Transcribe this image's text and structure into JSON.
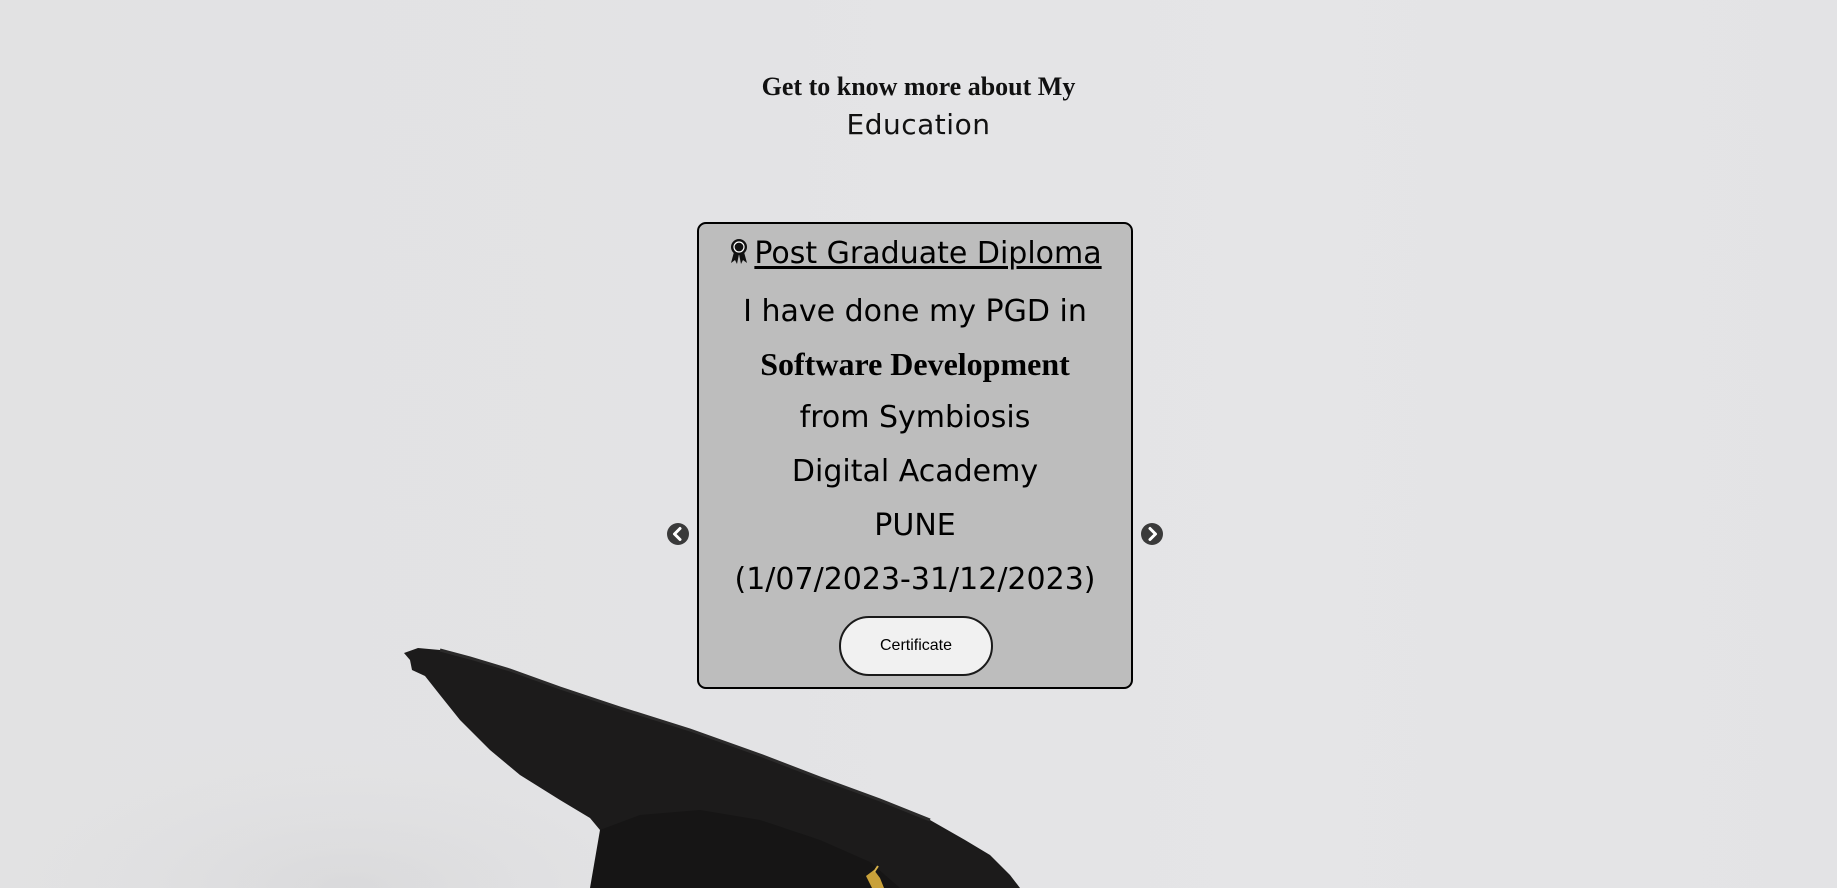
{
  "heading": {
    "line1": "Get to know more about My",
    "line2": "Education"
  },
  "card": {
    "title": "Post Graduate Diploma",
    "title_icon": "medal-icon",
    "lines": [
      "I have done my PGD in",
      "Software Development",
      "from Symbiosis",
      "Digital Academy",
      "PUNE",
      "(1/07/2023-31/12/2023)"
    ],
    "button_label": "Certificate"
  },
  "carousel": {
    "prev_icon": "chevron-circle-left-icon",
    "next_icon": "chevron-circle-right-icon"
  },
  "colors": {
    "card_background": "#bdbdbd",
    "page_background": "#e3e3e5",
    "button_background": "#f1f1f1"
  }
}
